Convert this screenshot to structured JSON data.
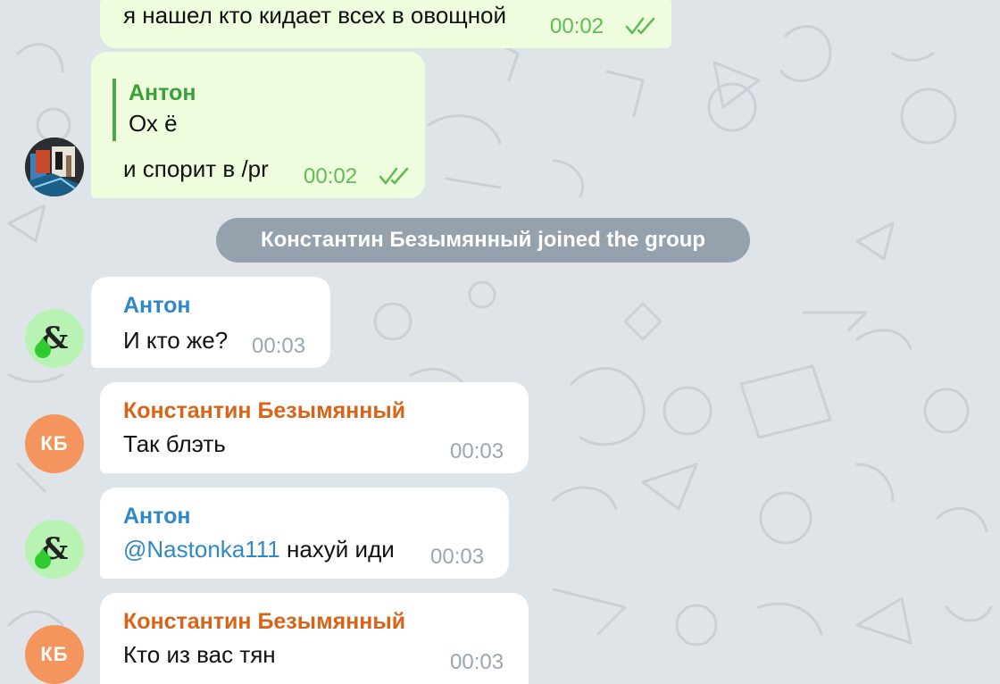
{
  "messages": [
    {
      "text": "я нашел кто кидает всех в овощной",
      "time": "00:02",
      "outgoing": true,
      "read": true
    },
    {
      "reply_to": {
        "name": "Антон",
        "text": "Ох ё"
      },
      "text": "и спорит в /pr",
      "time": "00:02",
      "outgoing": true,
      "read": true
    },
    {
      "author": "Антон",
      "text": "И кто же?",
      "time": "00:03"
    },
    {
      "author": "Константин Безымянный",
      "text": "Так блэть",
      "time": "00:03"
    },
    {
      "author": "Антон",
      "mention": "@Nastonka111",
      "text": " нахуй иди",
      "time": "00:03"
    },
    {
      "author": "Константин Безымянный",
      "text": "Кто из вас тян",
      "time": "00:03"
    }
  ],
  "service_message": "Константин Безымянный joined the group",
  "avatars": {
    "konstantin_initials": "КБ",
    "anton_icon": "ampersand-icon",
    "sender_icon": "photo-avatar-icon"
  },
  "colors": {
    "background": "#dfe4e8",
    "outgoing_bubble": "#effdde",
    "incoming_bubble": "#ffffff",
    "anton_name": "#2f88c7",
    "konstantin_name": "#d8641a",
    "kb_avatar": "#f5955e",
    "read_checks": "#5ebc53"
  }
}
